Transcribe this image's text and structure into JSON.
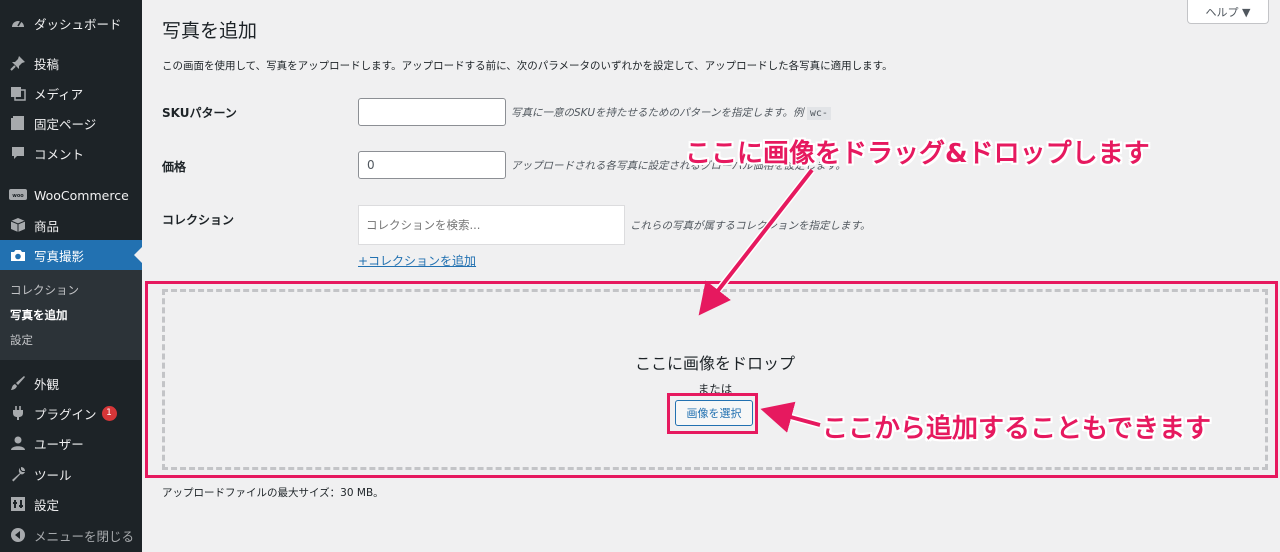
{
  "sidebar": {
    "items": [
      {
        "label": "ダッシュボード",
        "icon": "dashboard-icon"
      },
      {
        "label": "投稿",
        "icon": "pin-icon"
      },
      {
        "label": "メディア",
        "icon": "media-icon"
      },
      {
        "label": "固定ページ",
        "icon": "page-icon"
      },
      {
        "label": "コメント",
        "icon": "comment-icon"
      },
      {
        "label": "WooCommerce",
        "icon": "woo-icon"
      },
      {
        "label": "商品",
        "icon": "box-icon"
      },
      {
        "label": "写真撮影",
        "icon": "camera-icon"
      },
      {
        "label": "外観",
        "icon": "brush-icon"
      },
      {
        "label": "プラグイン",
        "icon": "plugin-icon",
        "badge": "1"
      },
      {
        "label": "ユーザー",
        "icon": "user-icon"
      },
      {
        "label": "ツール",
        "icon": "wrench-icon"
      },
      {
        "label": "設定",
        "icon": "settings-icon"
      },
      {
        "label": "メニューを閉じる",
        "icon": "collapse-icon"
      }
    ],
    "submenu": [
      "コレクション",
      "写真を追加",
      "設定"
    ],
    "active_index": 7,
    "current_submenu": 1
  },
  "header": {
    "help_label": "ヘルプ ▼"
  },
  "page": {
    "title": "写真を追加",
    "intro": "この画面を使用して、写真をアップロードします。アップロードする前に、次のパラメータのいずれかを設定して、アップロードした各写真に適用します。"
  },
  "form": {
    "sku": {
      "label": "SKUパターン",
      "value": "",
      "description": "写真に一意のSKUを持たせるためのパターンを指定します。例",
      "example": "wc-"
    },
    "price": {
      "label": "価格",
      "value": "0",
      "description": "アップロードされる各写真に設定されるグローバル価格を設定します。"
    },
    "collection": {
      "label": "コレクション",
      "placeholder": "コレクションを検索...",
      "description": "これらの写真が属するコレクションを指定します。",
      "add_link": "+コレクションを追加"
    }
  },
  "dropzone": {
    "title": "ここに画像をドロップ",
    "or": "または",
    "select_button": "画像を選択",
    "max_size": "アップロードファイルの最大サイズ：30 MB。"
  },
  "annotations": {
    "drag_drop": "ここに画像をドラッグ&ドロップします",
    "add_from_here": "ここから追加することもできます"
  },
  "colors": {
    "sidebar_bg": "#1d2327",
    "accent": "#2271b1",
    "annotation": "#e6195f",
    "badge": "#d63638"
  }
}
